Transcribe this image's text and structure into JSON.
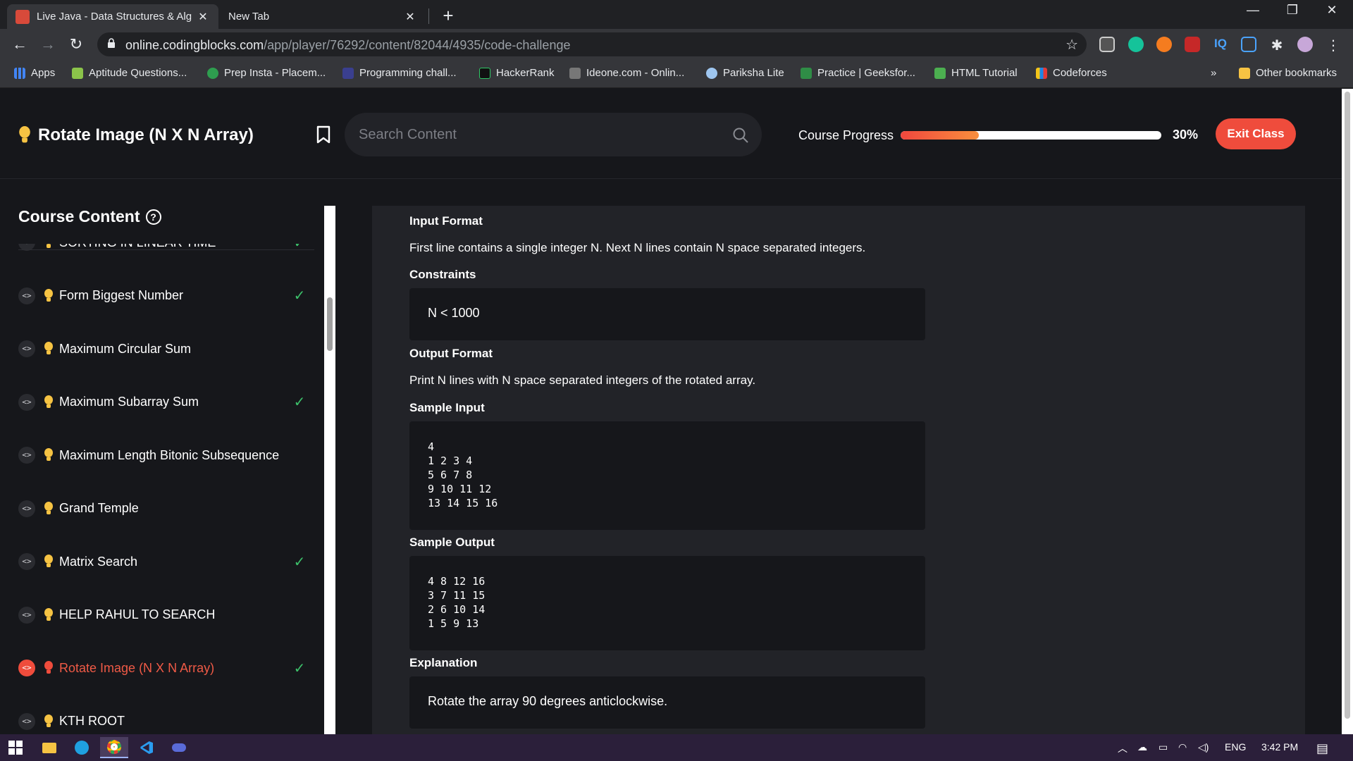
{
  "browser": {
    "tabs": [
      {
        "title": "Live Java - Data Structures & Alg",
        "active": true
      },
      {
        "title": "New Tab",
        "active": false
      }
    ],
    "url_host": "online.codingblocks.com",
    "url_path": "/app/player/76292/content/82044/4935/code-challenge",
    "bookmarks": [
      {
        "label": "Apps",
        "icon": "apps-grid-icon",
        "color": "#4285f4"
      },
      {
        "label": "Aptitude Questions...",
        "icon": "aptitude-icon",
        "color": "#8bc34a"
      },
      {
        "label": "Prep Insta - Placem...",
        "icon": "prepinsta-icon",
        "color": "#2e9e4f"
      },
      {
        "label": "Programming chall...",
        "icon": "programming-icon",
        "color": "#3a3f8f"
      },
      {
        "label": "HackerRank",
        "icon": "hackerrank-icon",
        "color": "#111111"
      },
      {
        "label": "Ideone.com - Onlin...",
        "icon": "ideone-icon",
        "color": "#777777"
      },
      {
        "label": "Pariksha Lite",
        "icon": "pariksha-icon",
        "color": "#9ec6f0"
      },
      {
        "label": "Practice | Geeksfor...",
        "icon": "geeksforgeeks-icon",
        "color": "#2f8d46"
      },
      {
        "label": "HTML Tutorial",
        "icon": "w3schools-icon",
        "color": "#4caf50"
      },
      {
        "label": "Codeforces",
        "icon": "codeforces-icon",
        "color": "#1e88e5"
      }
    ],
    "more_bookmarks": "»",
    "other_bookmarks": "Other bookmarks"
  },
  "header": {
    "title": "Rotate Image (N X N Array)",
    "search_placeholder": "Search Content",
    "progress_label": "Course Progress",
    "progress_value": 0.3,
    "progress_text": "30%",
    "exit_label": "Exit Class"
  },
  "sidebar": {
    "heading": "Course Content",
    "help": "?",
    "items": [
      {
        "label": "SORTING IN LINEAR TIME",
        "done": true,
        "active": false
      },
      {
        "label": "Form Biggest Number",
        "done": true,
        "active": false
      },
      {
        "label": "Maximum Circular Sum",
        "done": false,
        "active": false
      },
      {
        "label": "Maximum Subarray Sum",
        "done": true,
        "active": false
      },
      {
        "label": "Maximum Length Bitonic Subsequence",
        "done": false,
        "active": false
      },
      {
        "label": "Grand Temple",
        "done": false,
        "active": false
      },
      {
        "label": "Matrix Search",
        "done": true,
        "active": false
      },
      {
        "label": "HELP RAHUL TO SEARCH",
        "done": false,
        "active": false
      },
      {
        "label": "Rotate Image (N X N Array)",
        "done": true,
        "active": true
      },
      {
        "label": "KTH ROOT",
        "done": false,
        "active": false
      }
    ]
  },
  "problem": {
    "input_format_title": "Input Format",
    "input_format_text": "First line contains a single integer N. Next N lines contain N space separated integers.",
    "constraints_title": "Constraints",
    "constraints_text": "N < 1000",
    "output_format_title": "Output Format",
    "output_format_text": "Print N lines with N space separated integers of the rotated array.",
    "sample_input_title": "Sample Input",
    "sample_input": "4\n1 2 3 4\n5 6 7 8\n9 10 11 12\n13 14 15 16",
    "sample_output_title": "Sample Output",
    "sample_output": "4 8 12 16\n3 7 11 15\n2 6 10 14\n1 5 9 13",
    "explanation_title": "Explanation",
    "explanation_text": "Rotate the array 90 degrees anticlockwise."
  },
  "taskbar": {
    "lang": "ENG",
    "time": "3:42 PM"
  },
  "colors": {
    "accent": "#ef4c3c",
    "check": "#3cc06a",
    "bulb": "#f6c343"
  }
}
